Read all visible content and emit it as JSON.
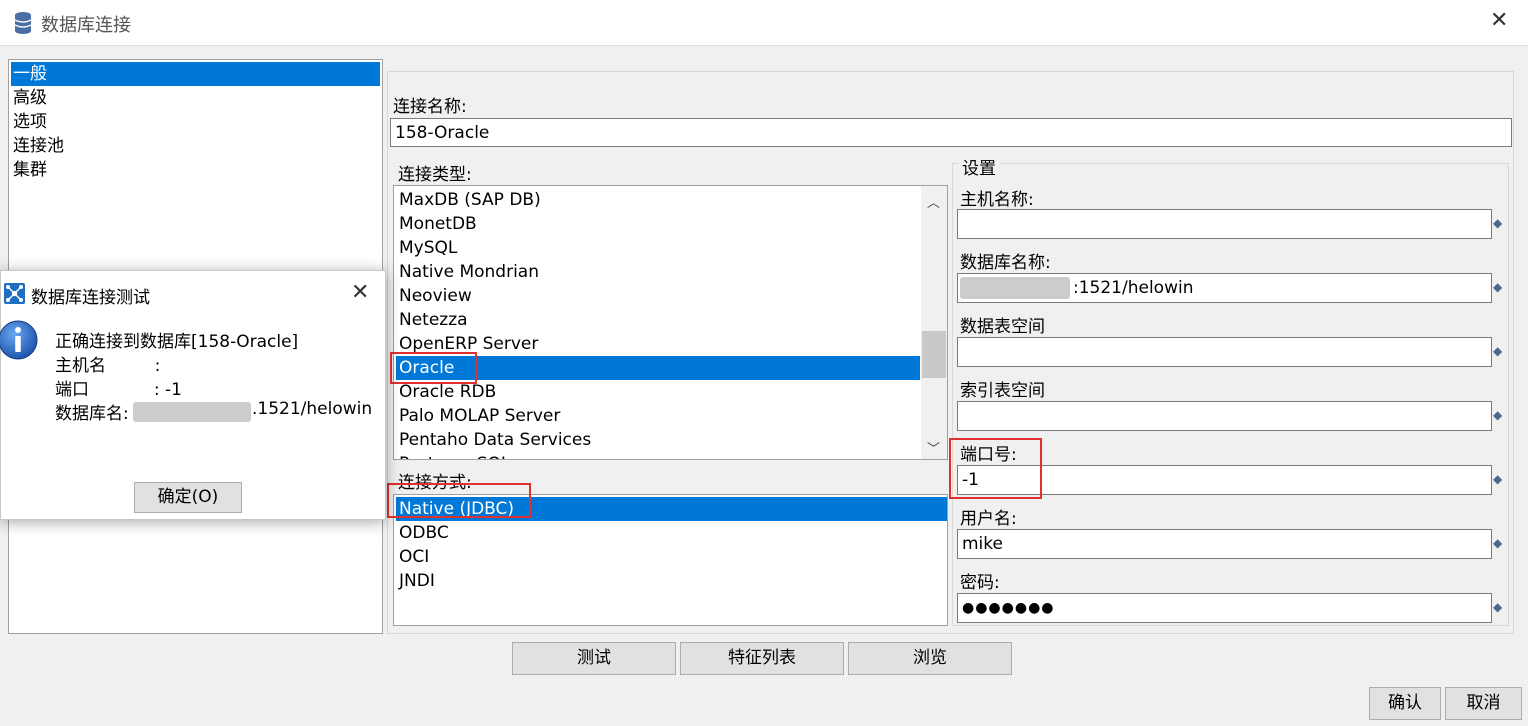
{
  "window": {
    "title": "数据库连接",
    "close": "✕"
  },
  "nav": {
    "items": [
      "一般",
      "高级",
      "选项",
      "连接池",
      "集群"
    ]
  },
  "connection_name": {
    "label": "连接名称:",
    "value": "158-Oracle"
  },
  "connection_type": {
    "label": "连接类型:",
    "items": [
      "MaxDB (SAP DB)",
      "MonetDB",
      "MySQL",
      "Native Mondrian",
      "Neoview",
      "Netezza",
      "OpenERP Server",
      "Oracle",
      "Oracle RDB",
      "Palo MOLAP Server",
      "Pentaho Data Services",
      "Postgres SQL"
    ],
    "selected": "Oracle"
  },
  "access_method": {
    "label": "连接方式:",
    "items": [
      "Native (JDBC)",
      "ODBC",
      "OCI",
      "JNDI"
    ],
    "selected": "Native (JDBC)"
  },
  "settings": {
    "legend": "设置",
    "host_label": "主机名称:",
    "host_value": "",
    "db_label": "数据库名称:",
    "db_value": ":1521/helowin",
    "tablespace_label": "数据表空间",
    "tablespace_value": "",
    "index_tablespace_label": "索引表空间",
    "index_tablespace_value": "",
    "port_label": "端口号:",
    "port_value": "-1",
    "user_label": "用户名:",
    "user_value": "mike",
    "password_label": "密码:",
    "password_value": "●●●●●●●"
  },
  "buttons": {
    "test": "测试",
    "features": "特征列表",
    "explore": "浏览",
    "ok": "确认",
    "cancel": "取消"
  },
  "dialog": {
    "title": "数据库连接测试",
    "close": "✕",
    "line1": "正确连接到数据库[158-Oracle]",
    "line2": "主机名         :",
    "line3": "端口            : -1",
    "line4_prefix": "数据库名:",
    "line4_suffix": ".1521/helowin",
    "ok": "确定(O)"
  },
  "colors": {
    "selection": "#0078d7",
    "highlight": "#e03030"
  }
}
